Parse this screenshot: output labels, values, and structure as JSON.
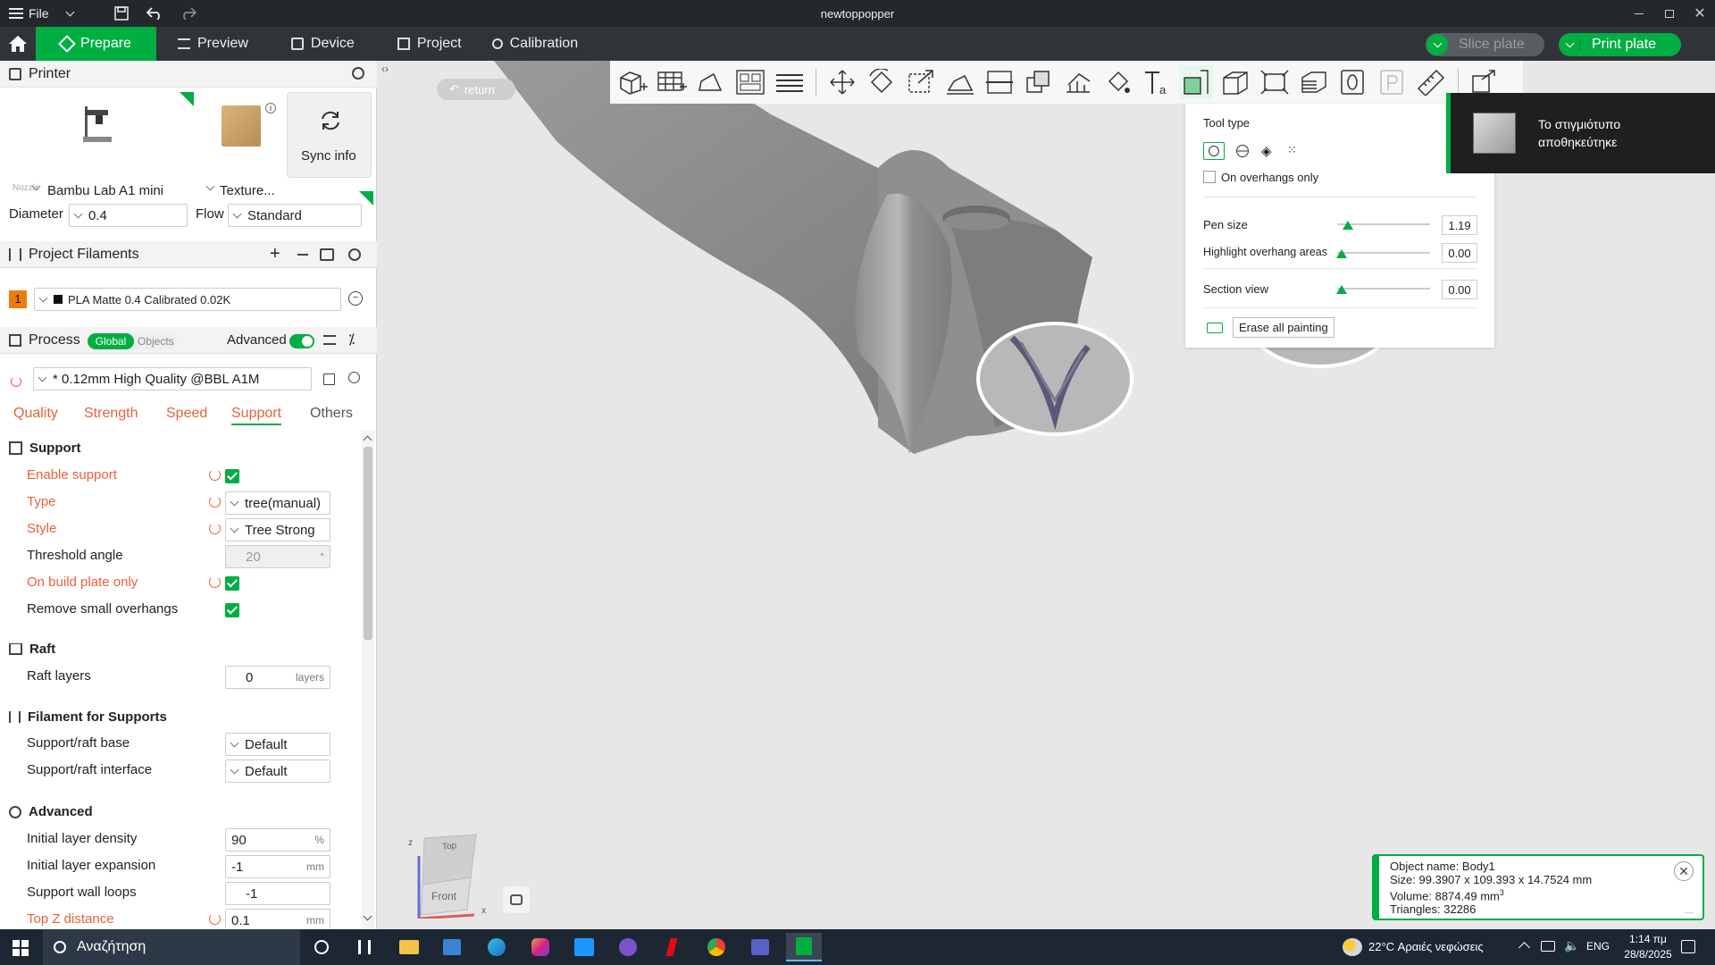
{
  "window": {
    "file_label": "File",
    "title": "newtoppopper"
  },
  "tabs": [
    {
      "label": "Prepare"
    },
    {
      "label": "Preview"
    },
    {
      "label": "Device"
    },
    {
      "label": "Project"
    },
    {
      "label": "Calibration"
    }
  ],
  "actions": {
    "slice_label": "Slice plate",
    "print_label": "Print plate"
  },
  "printer": {
    "section_title": "Printer",
    "printer_name": "Bambu Lab A1 mini",
    "plate_name": "Texture...",
    "sync_label": "Sync info",
    "nozzle_label": "Nozzle",
    "diameter_label": "Diameter",
    "diameter_value": "0.4",
    "flow_label": "Flow",
    "flow_value": "Standard"
  },
  "filaments": {
    "section_title": "Project Filaments",
    "items": [
      {
        "index": "1",
        "name": "PLA Matte 0.4 Calibrated 0.02K",
        "color": "#f07d0b"
      }
    ]
  },
  "process": {
    "section_title": "Process",
    "global_label": "Global",
    "objects_label": "Objects",
    "advanced_label": "Advanced",
    "preset": "* 0.12mm High Quality @BBL A1M",
    "tabs": [
      "Quality",
      "Strength",
      "Speed",
      "Support",
      "Others"
    ],
    "active_tab": "Support"
  },
  "support": {
    "group_title": "Support",
    "enable_label": "Enable support",
    "type_label": "Type",
    "type_value": "tree(manual)",
    "style_label": "Style",
    "style_value": "Tree Strong",
    "threshold_label": "Threshold angle",
    "threshold_value": "20",
    "build_plate_label": "On build plate only",
    "remove_small_label": "Remove small overhangs"
  },
  "raft": {
    "group_title": "Raft",
    "layers_label": "Raft layers",
    "layers_value": "0",
    "layers_unit": "layers"
  },
  "filament_supports": {
    "group_title": "Filament for Supports",
    "base_label": "Support/raft base",
    "base_value": "Default",
    "interface_label": "Support/raft interface",
    "interface_value": "Default"
  },
  "advanced": {
    "group_title": "Advanced",
    "density_label": "Initial layer density",
    "density_value": "90",
    "density_unit": "%",
    "expansion_label": "Initial layer expansion",
    "expansion_value": "-1",
    "expansion_unit": "mm",
    "wall_loops_label": "Support wall loops",
    "wall_loops_value": "-1",
    "top_z_label": "Top Z distance",
    "top_z_value": "0.1",
    "top_z_unit": "mm"
  },
  "viewport": {
    "return_label": "return",
    "cube_top": "Top",
    "cube_front": "Front",
    "axis_z": "z",
    "axis_x": "x"
  },
  "paint_panel": {
    "tool_type_label": "Tool type",
    "overhangs_only_label": "On overhangs only",
    "pen_size_label": "Pen size",
    "pen_size_value": "1.19",
    "highlight_label": "Highlight overhang areas",
    "highlight_value": "0.00",
    "section_view_label": "Section view",
    "section_view_value": "0.00",
    "erase_label": "Erase all painting",
    "pen_size_fraction": 0.12,
    "highlight_fraction": 0.05,
    "section_fraction": 0.05
  },
  "toast": {
    "line1": "Το στιγμιότυπο",
    "line2": "αποθηκεύτηκε"
  },
  "object_info": {
    "name": "Object name: Body1",
    "size": "Size: 99.3907 x 109.393 x 14.7524 mm",
    "volume": "Volume: 8874.49 mm",
    "volume_sup": "3",
    "triangles": "Triangles: 32286"
  },
  "taskbar": {
    "search_placeholder": "Αναζήτηση",
    "weather": "22°C  Αραιές νεφώσεις",
    "lang": "ENG",
    "time": "1:14 πμ",
    "date": "28/8/2025"
  },
  "colors": {
    "accent": "#00ae42",
    "modified": "#e8613a"
  }
}
